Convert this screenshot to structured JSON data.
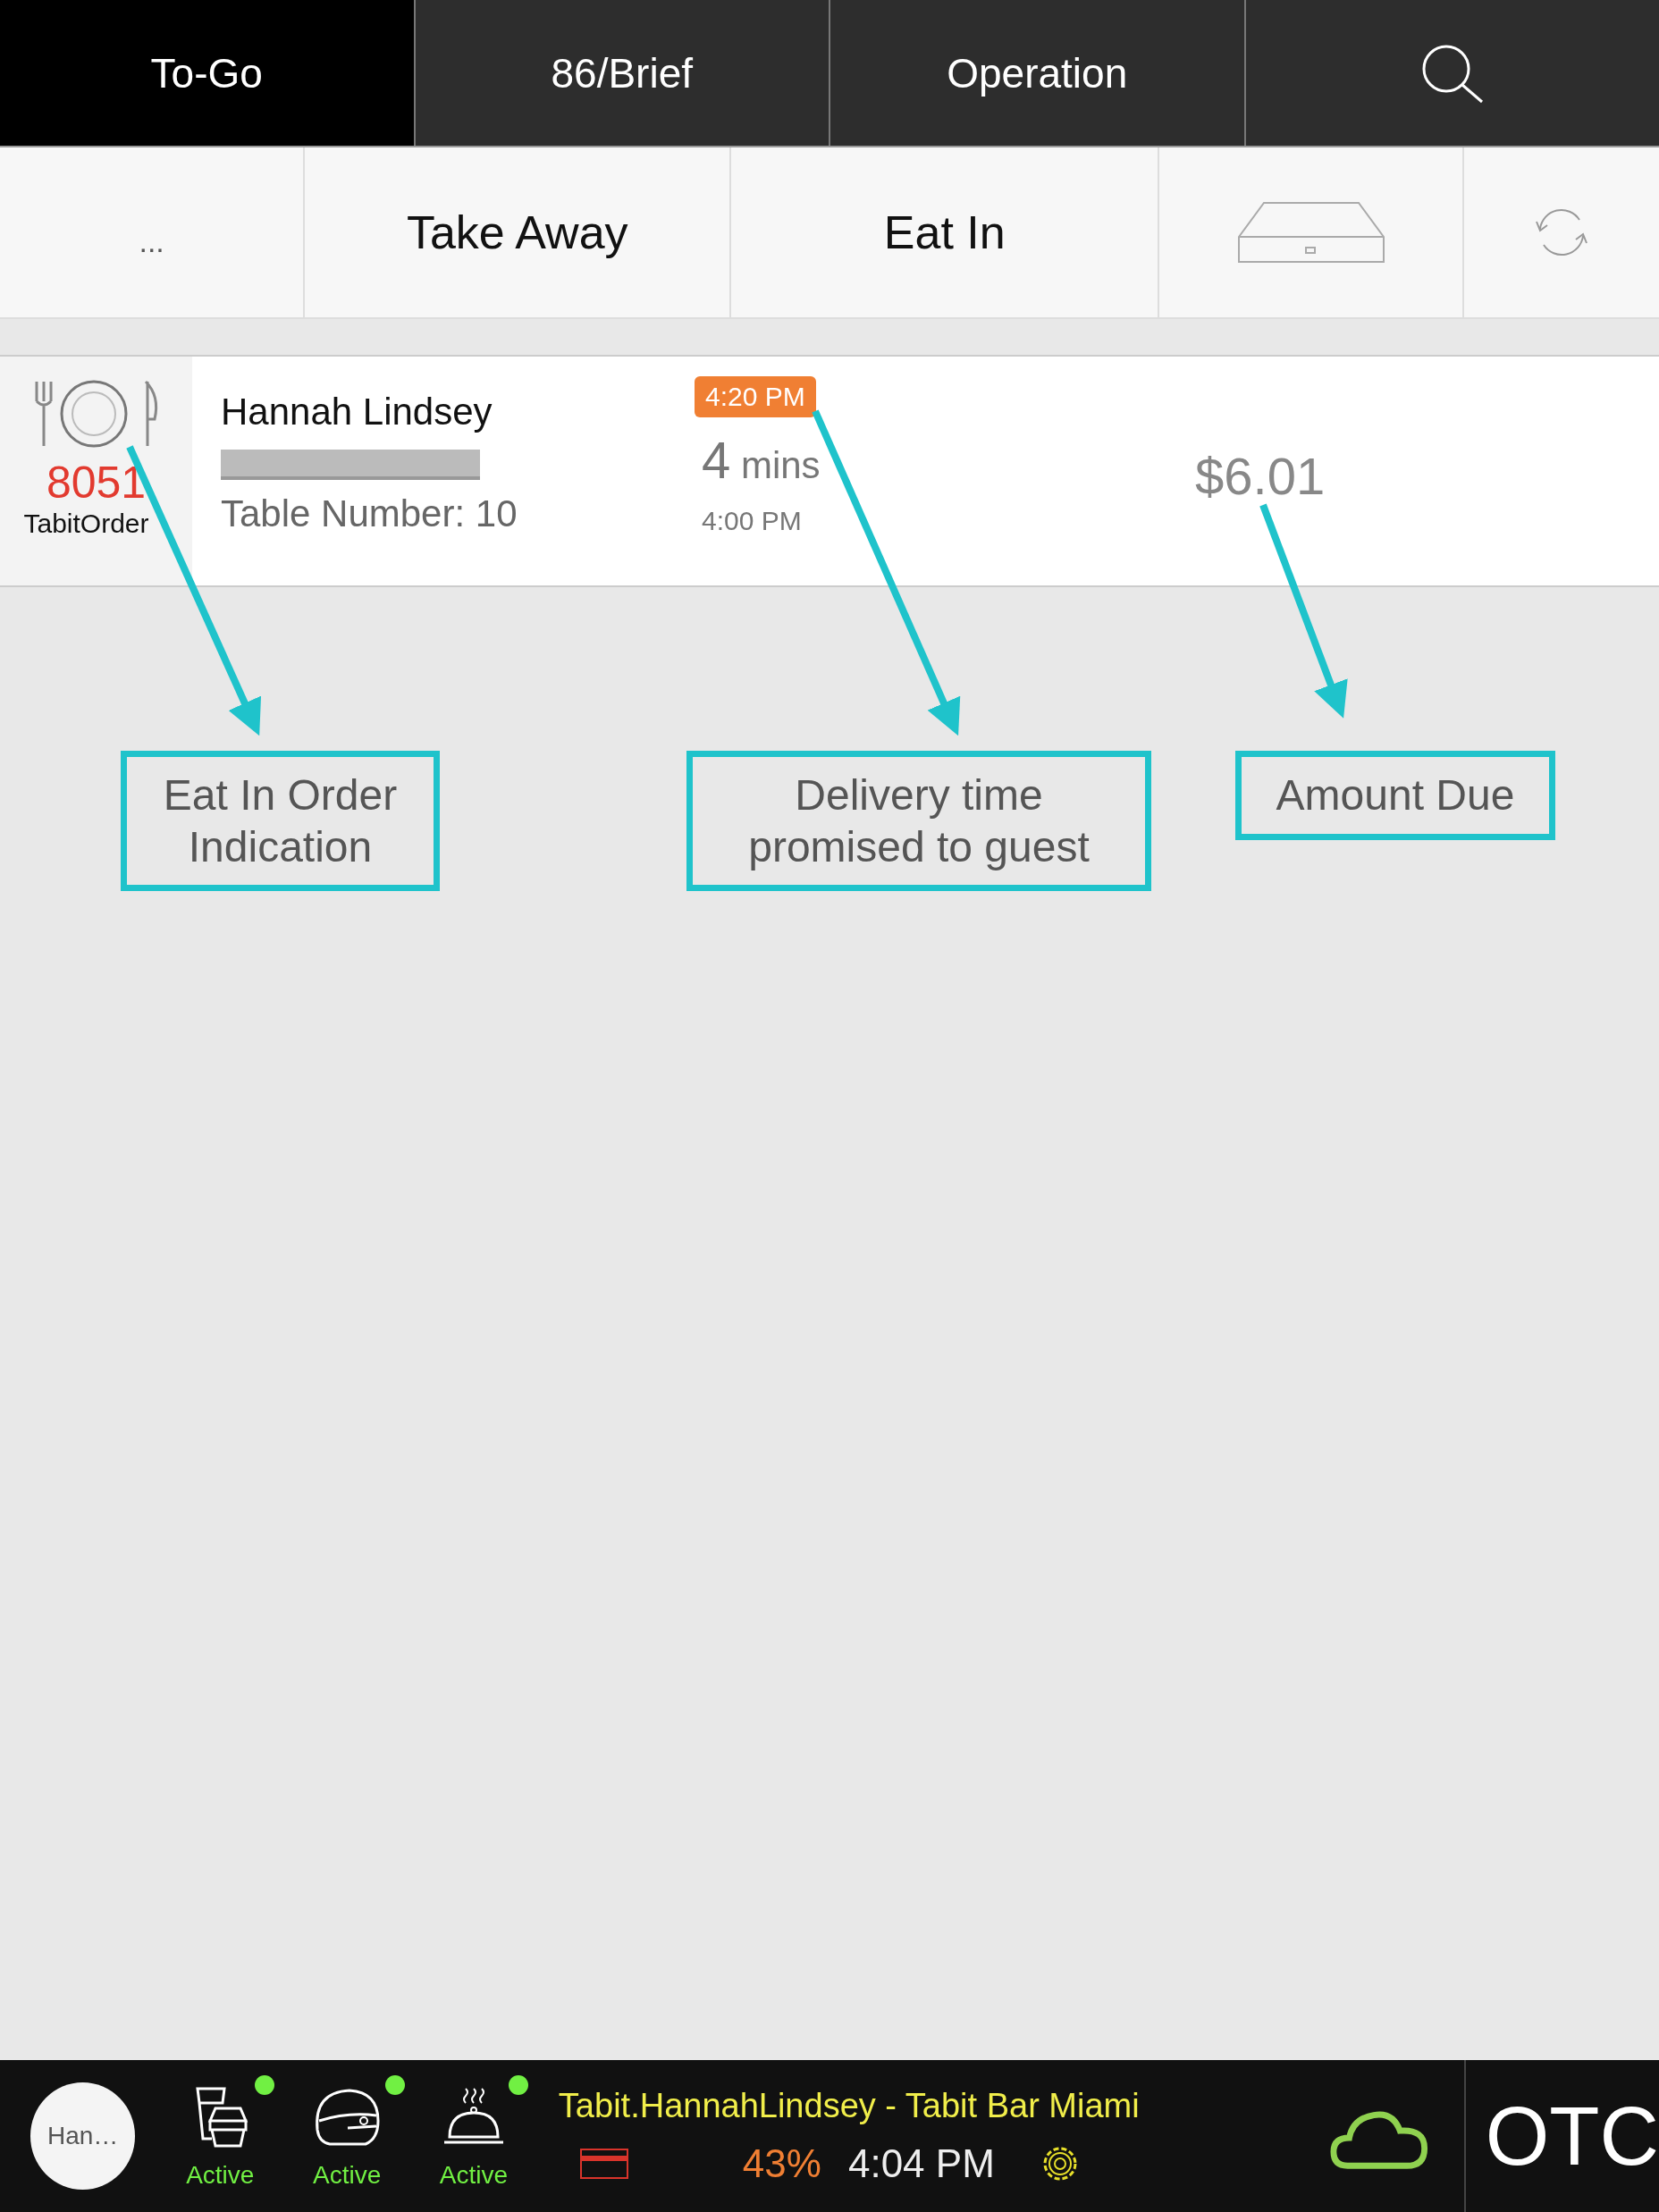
{
  "tabs": [
    {
      "kind": "text",
      "label": "To-Go",
      "selected": true
    },
    {
      "kind": "text",
      "label": "86/Brief",
      "selected": false
    },
    {
      "kind": "text",
      "label": "Operation",
      "selected": false
    },
    {
      "kind": "search",
      "selected": false
    }
  ],
  "filters": [
    {
      "kind": "text",
      "label": "..."
    },
    {
      "kind": "text",
      "label": "Take Away"
    },
    {
      "kind": "text",
      "label": "Eat In"
    },
    {
      "kind": "drawer"
    },
    {
      "kind": "refresh"
    }
  ],
  "order": {
    "kind": "eat-in",
    "number": "8051",
    "source": "TabitOrder",
    "name": "Hannah Lindsey",
    "phone_redacted": true,
    "table": "Table Number: 10",
    "promised_time": "4:20 PM",
    "elapsed_value": "4",
    "elapsed_unit": "mins",
    "ordered_time": "4:00 PM",
    "amount": "$6.01"
  },
  "annotations": [
    {
      "text": "Eat In Order Indication"
    },
    {
      "text": "Delivery time promised to guest"
    },
    {
      "text": "Amount Due"
    }
  ],
  "status_bar": {
    "user": "Han…",
    "modules": [
      {
        "kind": "takeaway",
        "status": "Active",
        "online": true
      },
      {
        "kind": "delivery",
        "status": "Active",
        "online": true
      },
      {
        "kind": "eat-in",
        "status": "Active",
        "online": true
      }
    ],
    "account": "Tabit.HannahLindsey - Tabit Bar Miami",
    "battery": "43%",
    "time": "4:04 PM",
    "cloud_connected": true,
    "register": "OTC"
  }
}
